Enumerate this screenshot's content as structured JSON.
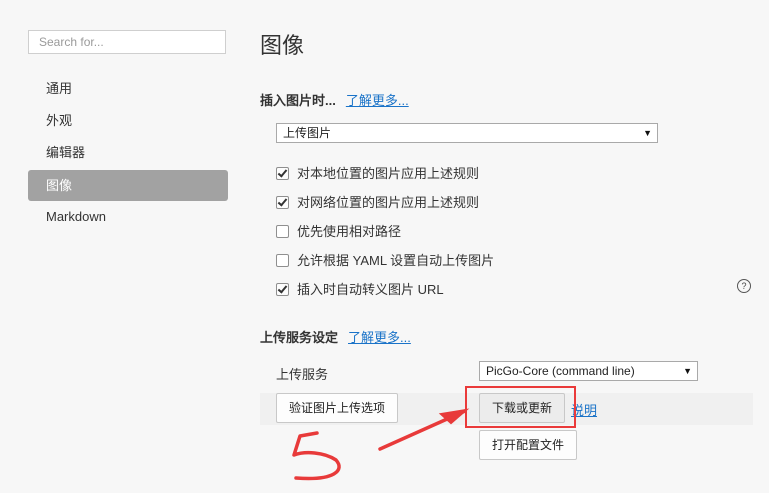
{
  "search": {
    "placeholder": "Search for..."
  },
  "sidebar": {
    "items": [
      {
        "label": "通用"
      },
      {
        "label": "外观"
      },
      {
        "label": "编辑器"
      },
      {
        "label": "图像",
        "active": true
      },
      {
        "label": "Markdown"
      }
    ]
  },
  "main": {
    "title": "图像",
    "insert": {
      "title": "插入图片时...",
      "learn_more": "了解更多...",
      "select_value": "上传图片",
      "options": [
        {
          "label": "对本地位置的图片应用上述规则",
          "checked": true
        },
        {
          "label": "对网络位置的图片应用上述规则",
          "checked": true
        },
        {
          "label": "优先使用相对路径",
          "checked": false
        },
        {
          "label": "允许根据 YAML 设置自动上传图片",
          "checked": false
        },
        {
          "label": "插入时自动转义图片 URL",
          "checked": true
        }
      ],
      "help": "?"
    },
    "upload": {
      "title": "上传服务设定",
      "learn_more": "了解更多...",
      "service_label": "上传服务",
      "service_value": "PicGo-Core (command line)",
      "verify_button": "验证图片上传选项",
      "download_button": "下载或更新",
      "explain_link": "说明",
      "open_config_button": "打开配置文件"
    }
  },
  "annotation": {
    "color": "#e83a3a"
  }
}
